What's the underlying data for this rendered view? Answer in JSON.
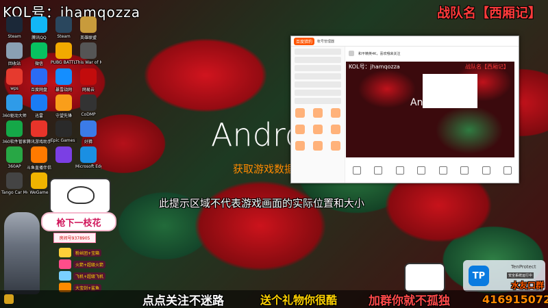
{
  "overlay": {
    "kol_text": "KOL号：jhamqozza",
    "team_text": "战队名【西厢记】",
    "android_text": "Android",
    "loading_text": "获取游戏数据中",
    "hint_text": "此提示区域不代表游戏画面的实际位置和大小"
  },
  "desktop": {
    "icons": [
      {
        "label": "Steam",
        "color": "#1b2838"
      },
      {
        "label": "腾讯QQ",
        "color": "#12b7f5"
      },
      {
        "label": "Steam",
        "color": "#2a475e"
      },
      {
        "label": "英雄联盟",
        "color": "#c89b3c"
      },
      {
        "label": "回收站",
        "color": "#8aa0b3"
      },
      {
        "label": "微信",
        "color": "#07c160"
      },
      {
        "label": "PUBG BATTLEGR...",
        "color": "#f2a900"
      },
      {
        "label": "This War of Mine",
        "color": "#555555"
      },
      {
        "label": "wps",
        "color": "#e63a2e"
      },
      {
        "label": "百度网盘",
        "color": "#2a6cf5"
      },
      {
        "label": "暴雪战网",
        "color": "#148eff"
      },
      {
        "label": "网易云",
        "color": "#c20c0c"
      },
      {
        "label": "360驱动大师",
        "color": "#2f9be8"
      },
      {
        "label": "迅雷",
        "color": "#1a7cf5"
      },
      {
        "label": "守望先锋",
        "color": "#f99e1a"
      },
      {
        "label": "CoDMP",
        "color": "#333333"
      },
      {
        "label": "360软件管家",
        "color": "#15a848"
      },
      {
        "label": "腾讯游戏助手",
        "color": "#e8342a"
      },
      {
        "label": "Epic Games Launcher",
        "color": "#2a2a2a"
      },
      {
        "label": "好猜",
        "color": "#3b7be8"
      },
      {
        "label": "360AP",
        "color": "#28a745"
      },
      {
        "label": "斗鱼直播伴侣",
        "color": "#ff7a00"
      },
      {
        "label": "",
        "color": "#7b3fe4"
      },
      {
        "label": "Microsoft Edge",
        "color": "#1a8fe3"
      },
      {
        "label": "Tango Car Mod",
        "color": "#444444"
      },
      {
        "label": "WeGame",
        "color": "#f0b400"
      }
    ]
  },
  "app_window": {
    "logo_text": "百度猎豹",
    "title_text": "帐号管理器",
    "tab_text": "和平精英4K，喜欢哦来关注",
    "preview_kol": "KOL号：jhamqozza",
    "preview_team": "战队名【西厢记】",
    "preview_android": "Android"
  },
  "stickers": {
    "flower_sign": "枪下一枝花",
    "room_id": "房间号9378905"
  },
  "gifts": [
    {
      "label": "粉丝团+宝箱",
      "color": "#ffcf3a"
    },
    {
      "label": "火箭+超级火箭",
      "color": "#ff4d8a"
    },
    {
      "label": "飞机+超级飞机",
      "color": "#7ad0ff"
    },
    {
      "label": "大宝剑+鲨鱼",
      "color": "#ff8a00"
    }
  ],
  "tp_badge": {
    "logo": "TP",
    "title": "TenProtect",
    "subtitle": "安全系统运行中",
    "slogan": "水友口群"
  },
  "ticker": {
    "part_a": "点点关注不迷路",
    "part_b": "送个礼物你很酷",
    "part_c": "加群你就不孤独",
    "part_d": "416915072"
  }
}
